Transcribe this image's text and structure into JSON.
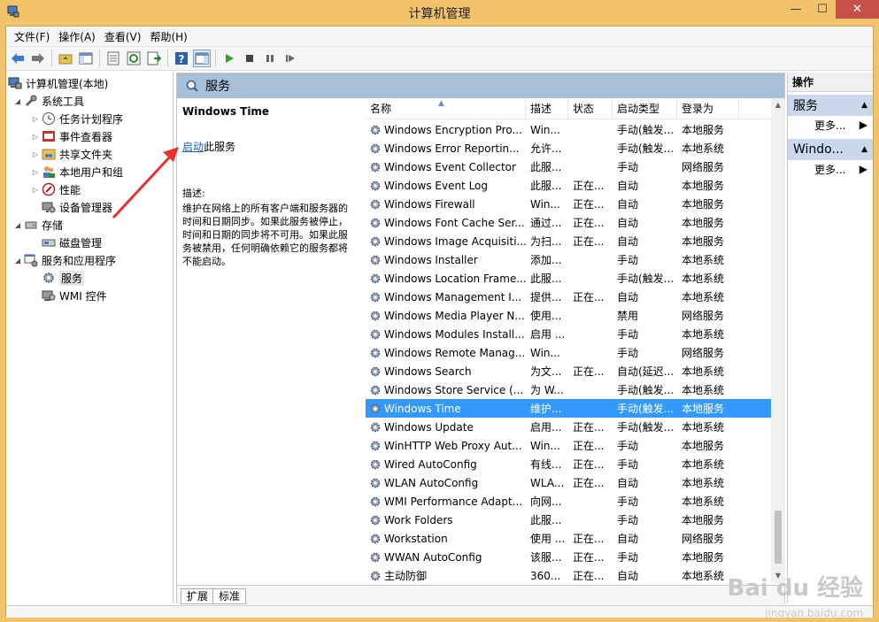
{
  "window": {
    "title": "计算机管理",
    "minimize": "—",
    "maximize": "☐",
    "close": "✕"
  },
  "menu": [
    "文件(F)",
    "操作(A)",
    "查看(V)",
    "帮助(H)"
  ],
  "tree": {
    "root": "计算机管理(本地)",
    "system_tools": "系统工具",
    "task_scheduler": "任务计划程序",
    "event_viewer": "事件查看器",
    "shared_folders": "共享文件夹",
    "local_users": "本地用户和组",
    "performance": "性能",
    "device_manager": "设备管理器",
    "storage": "存储",
    "disk_management": "磁盘管理",
    "services_apps": "服务和应用程序",
    "services": "服务",
    "wmi": "WMI 控件"
  },
  "main": {
    "header": "服务",
    "service_name": "Windows Time",
    "start_link": "启动",
    "start_suffix": "此服务",
    "desc_label": "描述:",
    "desc_text": "维护在网络上的所有客户端和服务器的时间和日期同步。如果此服务被停止，时间和日期的同步将不可用。如果此服务被禁用，任何明确依赖它的服务都将不能启动。"
  },
  "columns": [
    "名称",
    "描述",
    "状态",
    "启动类型",
    "登录为"
  ],
  "rows": [
    {
      "name": "Windows Encryption Pro...",
      "desc": "Win...",
      "status": "",
      "type": "手动(触发...",
      "logon": "本地服务"
    },
    {
      "name": "Windows Error Reportin...",
      "desc": "允许...",
      "status": "",
      "type": "手动(触发...",
      "logon": "本地系统"
    },
    {
      "name": "Windows Event Collector",
      "desc": "此服...",
      "status": "",
      "type": "手动",
      "logon": "网络服务"
    },
    {
      "name": "Windows Event Log",
      "desc": "此服...",
      "status": "正在...",
      "type": "自动",
      "logon": "本地服务"
    },
    {
      "name": "Windows Firewall",
      "desc": "Win...",
      "status": "正在...",
      "type": "自动",
      "logon": "本地服务"
    },
    {
      "name": "Windows Font Cache Ser...",
      "desc": "通过...",
      "status": "正在...",
      "type": "自动",
      "logon": "本地服务"
    },
    {
      "name": "Windows Image Acquisiti...",
      "desc": "为扫...",
      "status": "正在...",
      "type": "自动",
      "logon": "本地服务"
    },
    {
      "name": "Windows Installer",
      "desc": "添加...",
      "status": "",
      "type": "手动",
      "logon": "本地系统"
    },
    {
      "name": "Windows Location Frame...",
      "desc": "此服...",
      "status": "",
      "type": "手动(触发...",
      "logon": "本地系统"
    },
    {
      "name": "Windows Management I...",
      "desc": "提供...",
      "status": "正在...",
      "type": "自动",
      "logon": "本地系统"
    },
    {
      "name": "Windows Media Player N...",
      "desc": "使用...",
      "status": "",
      "type": "禁用",
      "logon": "网络服务"
    },
    {
      "name": "Windows Modules Install...",
      "desc": "启用 ...",
      "status": "",
      "type": "手动",
      "logon": "本地系统"
    },
    {
      "name": "Windows Remote Manag...",
      "desc": "Win...",
      "status": "",
      "type": "手动",
      "logon": "网络服务"
    },
    {
      "name": "Windows Search",
      "desc": "为文...",
      "status": "正在...",
      "type": "自动(延迟...",
      "logon": "本地系统"
    },
    {
      "name": "Windows Store Service (...",
      "desc": "为 W...",
      "status": "",
      "type": "手动(触发...",
      "logon": "本地系统"
    },
    {
      "name": "Windows Time",
      "desc": "维护...",
      "status": "",
      "type": "手动(触发...",
      "logon": "本地服务"
    },
    {
      "name": "Windows Update",
      "desc": "启用...",
      "status": "正在...",
      "type": "手动(触发...",
      "logon": "本地系统"
    },
    {
      "name": "WinHTTP Web Proxy Aut...",
      "desc": "Win...",
      "status": "正在...",
      "type": "手动",
      "logon": "本地服务"
    },
    {
      "name": "Wired AutoConfig",
      "desc": "有线...",
      "status": "正在...",
      "type": "手动",
      "logon": "本地系统"
    },
    {
      "name": "WLAN AutoConfig",
      "desc": "WLA...",
      "status": "正在...",
      "type": "自动",
      "logon": "本地系统"
    },
    {
      "name": "WMI Performance Adapt...",
      "desc": "向网...",
      "status": "",
      "type": "手动",
      "logon": "本地系统"
    },
    {
      "name": "Work Folders",
      "desc": "此服...",
      "status": "",
      "type": "手动",
      "logon": "本地服务"
    },
    {
      "name": "Workstation",
      "desc": "使用 ...",
      "status": "正在...",
      "type": "自动",
      "logon": "网络服务"
    },
    {
      "name": "WWAN AutoConfig",
      "desc": "该服...",
      "status": "正在...",
      "type": "手动",
      "logon": "本地服务"
    },
    {
      "name": "主动防御",
      "desc": "360...",
      "status": "正在...",
      "type": "自动",
      "logon": "本地系统"
    }
  ],
  "tabs": [
    "扩展",
    "标准"
  ],
  "actions": {
    "title": "操作",
    "group1": "服务",
    "more1": "更多...",
    "group2": "Windo...",
    "more2": "更多..."
  },
  "watermark": {
    "main": "Bai du 经验",
    "sub": "jingyan.baidu.com"
  },
  "colors": {
    "titlebar": "#f2c36b",
    "selection": "#3399ff",
    "header": "#a8bfd9",
    "link": "#1a5fb4",
    "arrow": "#e8312a"
  }
}
